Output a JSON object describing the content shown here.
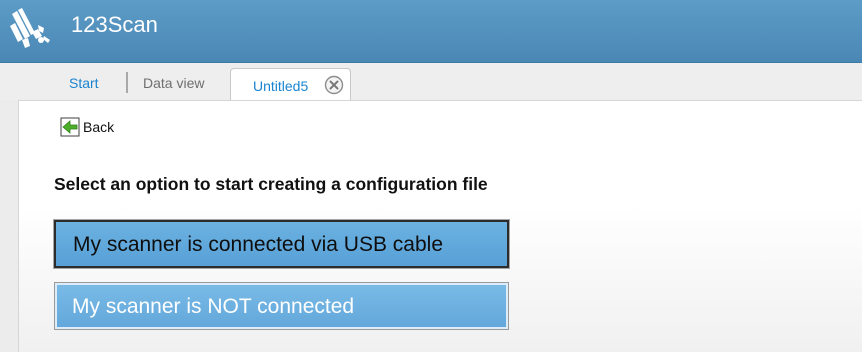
{
  "app": {
    "title": "123Scan",
    "logo_icon": "zebra-head-logo",
    "header_color": "#5a97c3"
  },
  "tabs": [
    {
      "label": "Start",
      "active": false
    },
    {
      "label": "Data view",
      "active": false
    },
    {
      "label": "Untitled5",
      "active": true,
      "close_icon": "close-circle-icon"
    }
  ],
  "content": {
    "back": {
      "label": "Back",
      "icon": "back-arrow-icon"
    },
    "heading": "Select an option to start creating a configuration file",
    "options": [
      {
        "label": "My scanner is connected via USB cable",
        "focused": true
      },
      {
        "label": "My scanner is NOT connected",
        "focused": false
      }
    ]
  },
  "colors": {
    "accent_link": "#1a84d0",
    "button_fill": "#62a7db",
    "back_arrow": "#4caf2a"
  }
}
